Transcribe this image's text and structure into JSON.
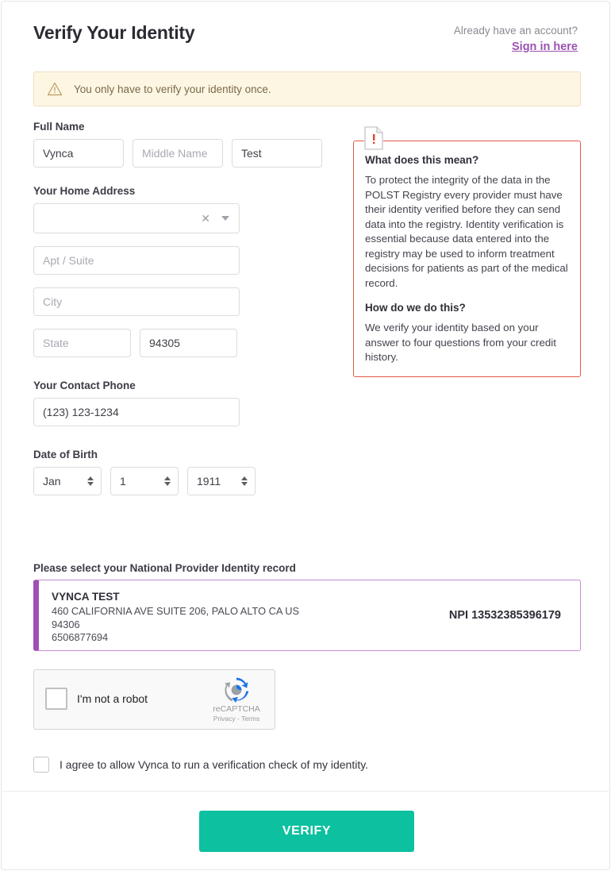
{
  "header": {
    "title": "Verify Your Identity",
    "account_prompt": "Already have an account?",
    "signin_label": "Sign in here"
  },
  "notice": {
    "icon": "warning-triangle-icon",
    "text": "You only have to verify your identity once."
  },
  "form": {
    "full_name": {
      "label": "Full Name",
      "first_value": "Vynca",
      "middle_placeholder": "Middle Name",
      "last_value": "Test"
    },
    "home_address": {
      "label": "Your Home Address",
      "select_value": "",
      "clear_icon": "clear-x-icon",
      "caret_icon": "chevron-down-icon",
      "apt_placeholder": "Apt / Suite",
      "city_placeholder": "City",
      "state_placeholder": "State",
      "zip_value": "94305"
    },
    "phone": {
      "label": "Your Contact Phone",
      "value": "(123) 123-1234"
    },
    "dob": {
      "label": "Date of Birth",
      "month": "Jan",
      "day": "1",
      "year": "1911"
    }
  },
  "info_panel": {
    "icon": "document-alert-icon",
    "heading_1": "What does this mean?",
    "body_1": "To protect the integrity of the data in the POLST Registry every provider must have their identity verified before they can send data into the registry. Identity verification is essential because data entered into the registry may be used to inform treatment decisions for patients as part of the medical record.",
    "heading_2": "How do we do this?",
    "body_2": "We verify your identity based on your answer to four questions from your credit history.",
    "border_color": "#e05a45"
  },
  "npi": {
    "label": "Please select your National Provider Identity record",
    "record": {
      "name": "VYNCA TEST",
      "address": "460 CALIFORNIA AVE SUITE 206, PALO ALTO CA US",
      "zip": "94306",
      "phone": "6506877694",
      "npi_number": "NPI 13532385396179"
    },
    "accent_color": "#a04fb5"
  },
  "recaptcha": {
    "checkbox_label": "I'm not a robot",
    "brand": "reCAPTCHA",
    "terms": "Privacy - Terms",
    "logo_icon": "recaptcha-logo-icon"
  },
  "agreement": {
    "text": "I agree to allow Vynca to run a verification check of my identity."
  },
  "footer": {
    "verify_label": "VERIFY",
    "button_color": "#0cc0a0"
  }
}
